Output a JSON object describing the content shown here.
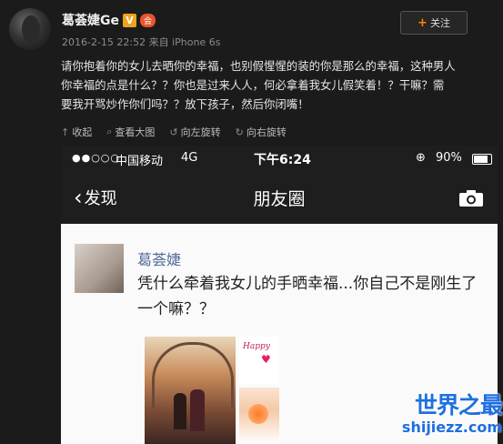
{
  "post": {
    "username": "葛荟婕Ge",
    "v_badge": "V",
    "member_badge": "会",
    "meta": "2016-2-15 22:52 来自 iPhone 6s",
    "follow_label": "关注",
    "follow_plus": "+",
    "content_lines": [
      "请你抱着你的女儿去晒你的幸福，也别假惺惺的装的你是那么的幸福，这种男人",
      "你幸福的点是什么？？你也是过来人人，何必拿着我女儿假笑着！？干嘛？需",
      "要我开骂炒作你们吗？？放下孩子，然后你闭嘴！"
    ]
  },
  "toolbar": {
    "collapse": "收起",
    "view_large": "查看大图",
    "rotate_left": "向左旋转",
    "rotate_right": "向右旋转"
  },
  "phone": {
    "signal": "●●○○○",
    "carrier": "中国移动",
    "network": "4G",
    "time": "下午6:24",
    "lock": "⊕",
    "battery": "90%",
    "back_label": "发现",
    "title": "朋友圈"
  },
  "moment": {
    "name": "葛荟婕",
    "text": "凭什么牵着我女儿的手晒幸福...你自己不是刚生了一个嘛？？",
    "photo_script": "Happy"
  },
  "watermark": {
    "top": "世界之最",
    "bottom": "shijiezz.com"
  },
  "colors": {
    "background": "#1b1b1b",
    "accent_orange": "#ff8200",
    "link_blue": "#546a9c",
    "watermark_blue": "#1e6fe0"
  }
}
